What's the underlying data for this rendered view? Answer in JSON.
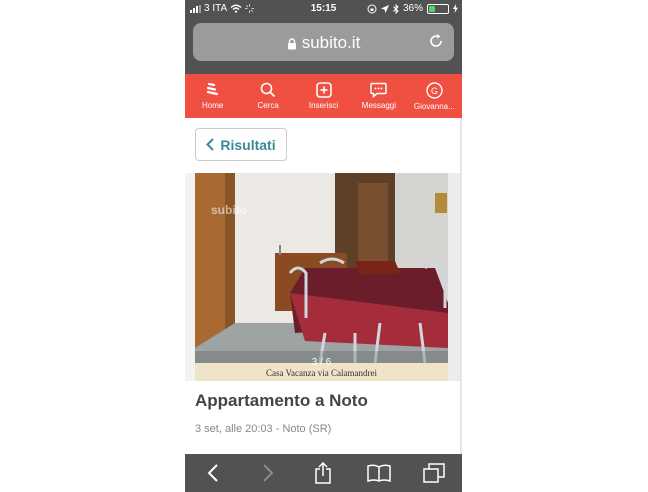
{
  "status": {
    "carrier": "3 ITA",
    "time": "15:15",
    "battery": "36%",
    "battery_level": 0.36
  },
  "browser": {
    "domain": "subito.it"
  },
  "nav": {
    "items": [
      {
        "label": "Home",
        "icon": "home-icon"
      },
      {
        "label": "Cerca",
        "icon": "search-icon"
      },
      {
        "label": "Inserisci",
        "icon": "plus-square-icon"
      },
      {
        "label": "Messaggi",
        "icon": "message-icon"
      },
      {
        "label": "Giovanna...",
        "icon": "avatar-icon",
        "avatar_letter": "G"
      }
    ],
    "color": "#ef5042"
  },
  "back_label": "Risultati",
  "photo": {
    "counter": "3 / 6",
    "caption": "Casa Vacanza via Calamandrei",
    "watermark": "subito"
  },
  "listing": {
    "title": "Appartamento a Noto",
    "meta": "3 set, alle 20:03 - Noto (SR)"
  },
  "colors": {
    "accent": "#3a8a94",
    "chrome": "#525252"
  }
}
